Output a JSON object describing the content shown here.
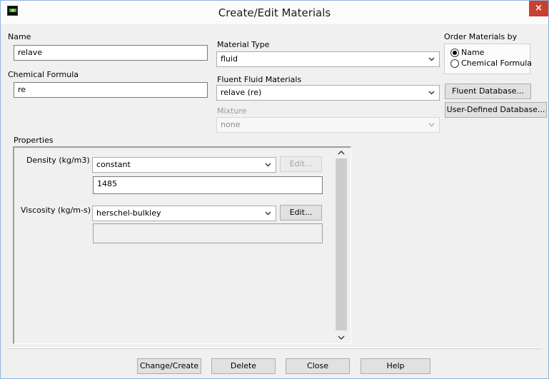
{
  "window": {
    "title": "Create/Edit Materials",
    "close": "×"
  },
  "name": {
    "label": "Name",
    "value": "relave"
  },
  "chemical_formula": {
    "label": "Chemical Formula",
    "value": "re"
  },
  "material_type": {
    "label": "Material Type",
    "value": "fluid"
  },
  "fluent_fluid_materials": {
    "label": "Fluent Fluid Materials",
    "value": "relave (re)"
  },
  "mixture": {
    "label": "Mixture",
    "value": "none"
  },
  "order_by": {
    "label": "Order Materials by",
    "options": [
      {
        "label": "Name",
        "selected": true
      },
      {
        "label": "Chemical Formula",
        "selected": false
      }
    ]
  },
  "database_buttons": {
    "fluent": "Fluent Database...",
    "user_defined": "User-Defined Database..."
  },
  "properties": {
    "label": "Properties",
    "density": {
      "label": "Density (kg/m3)",
      "method": "constant",
      "edit": "Edit...",
      "value": "1485"
    },
    "viscosity": {
      "label": "Viscosity (kg/m-s)",
      "method": "herschel-bulkley",
      "edit": "Edit...",
      "value": ""
    }
  },
  "actions": {
    "change_create": "Change/Create",
    "delete": "Delete",
    "close": "Close",
    "help": "Help"
  },
  "icons": {
    "app": "fluent-app-icon",
    "dropdown": "chevron-down-icon",
    "scroll_up": "chevron-up-icon",
    "scroll_down": "chevron-down-icon"
  },
  "colors": {
    "close_button": "#c84031",
    "window_border": "#8fb3dc"
  }
}
